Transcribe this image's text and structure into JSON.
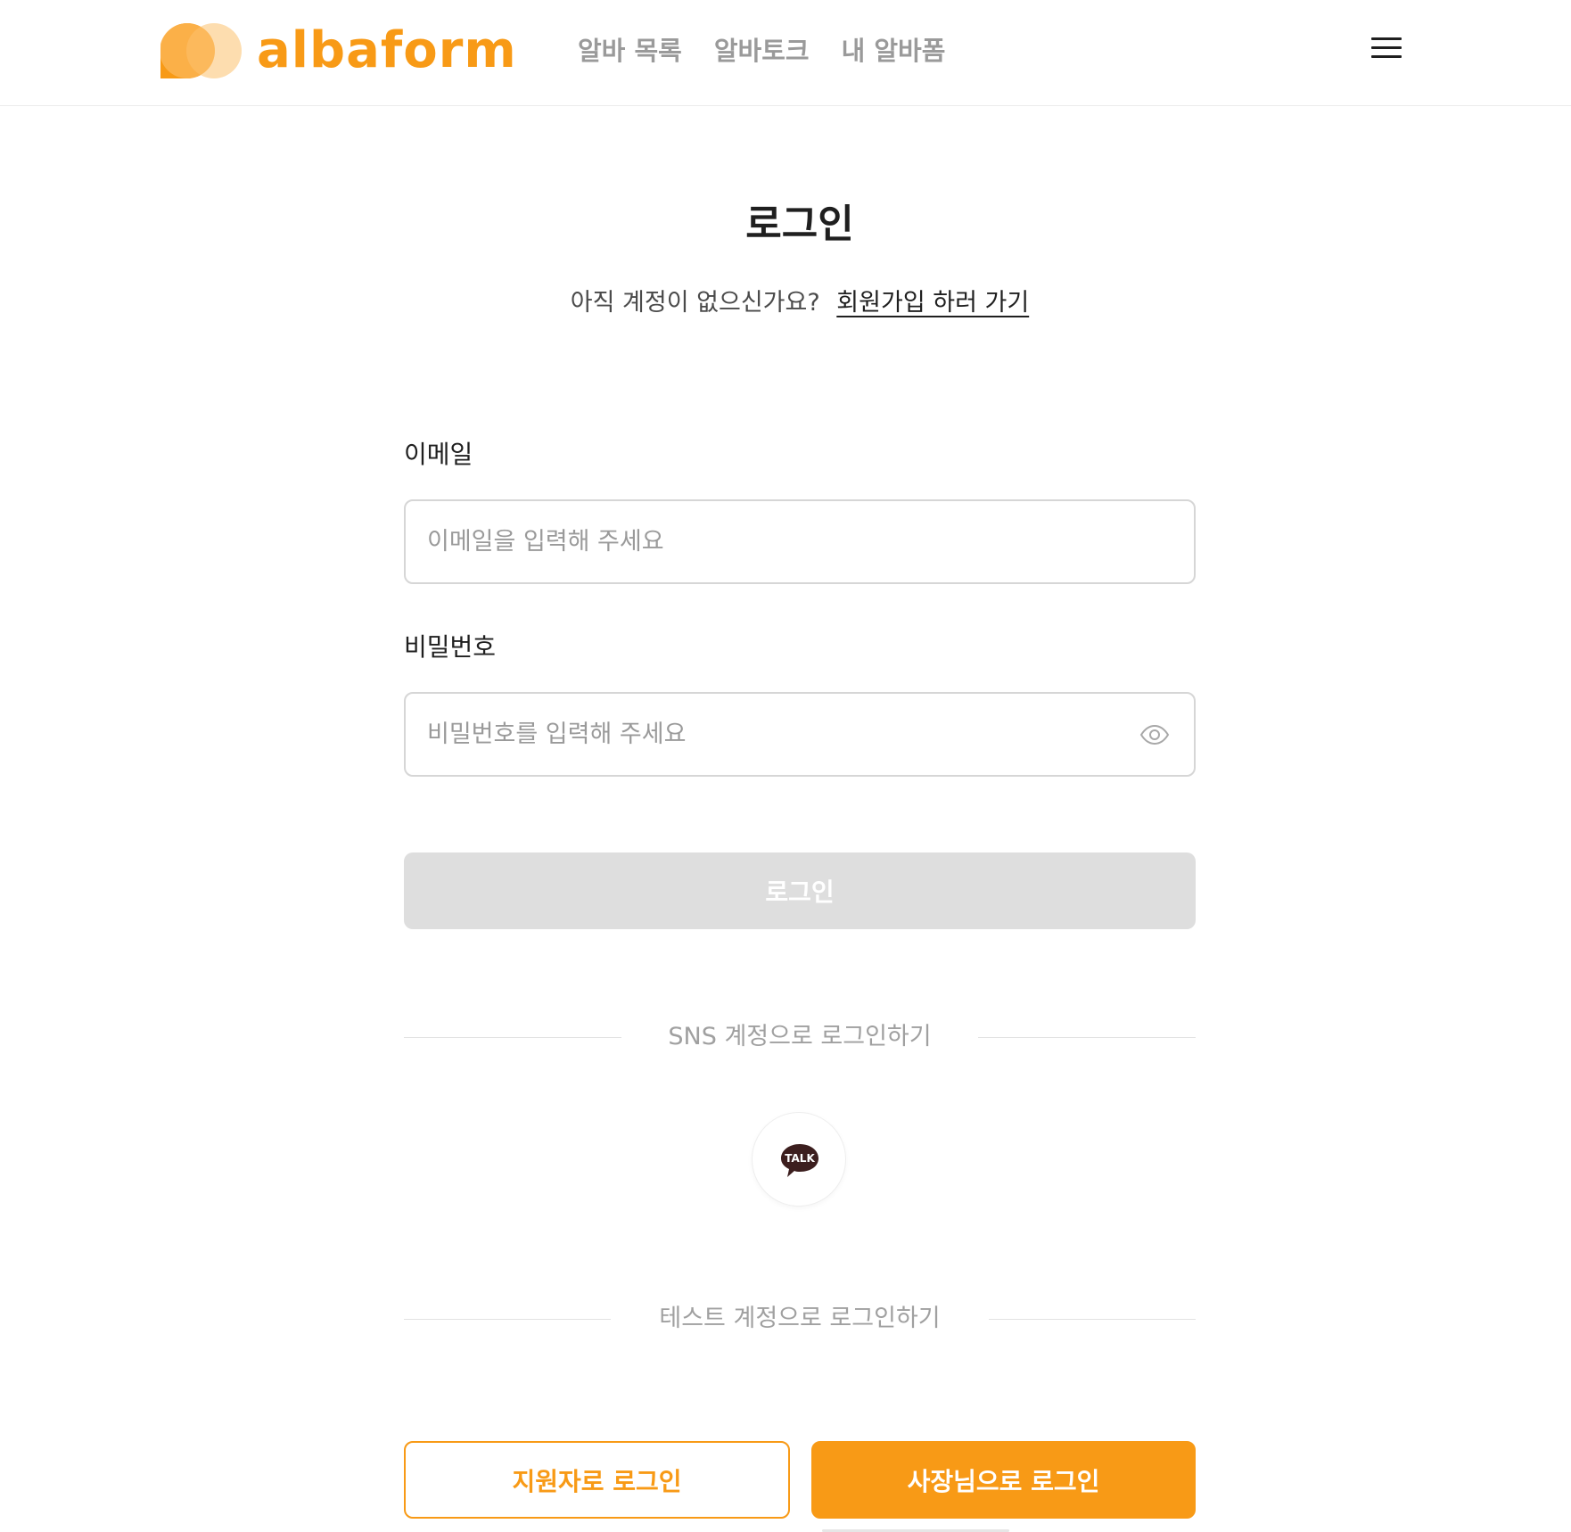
{
  "header": {
    "logo_text": "albaform",
    "nav": [
      {
        "label": "알바 목록"
      },
      {
        "label": "알바토크"
      },
      {
        "label": "내 알바폼"
      }
    ],
    "menu_icon": "hamburger-menu-icon"
  },
  "main": {
    "title": "로그인",
    "signup_prompt": "아직 계정이 없으신가요?",
    "signup_link": "회원가입 하러 가기",
    "email": {
      "label": "이메일",
      "placeholder": "이메일을 입력해 주세요",
      "value": ""
    },
    "password": {
      "label": "비밀번호",
      "placeholder": "비밀번호를 입력해 주세요",
      "value": "",
      "toggle_icon": "eye-icon"
    },
    "login_button": "로그인",
    "sns_divider": "SNS 계정으로 로그인하기",
    "kakao": {
      "icon": "kakao-talk-icon",
      "label": "TALK"
    },
    "test_divider": "테스트 계정으로 로그인하기",
    "test_applicant_button": "지원자로 로그인",
    "test_owner_button": "사장님으로 로그인"
  },
  "colors": {
    "brand": "#F89A16",
    "brand_light": "#FDD9A6",
    "disabled_button": "#DEDEDE",
    "text_primary": "#1F1F1F",
    "text_muted": "#9A9A9A"
  }
}
